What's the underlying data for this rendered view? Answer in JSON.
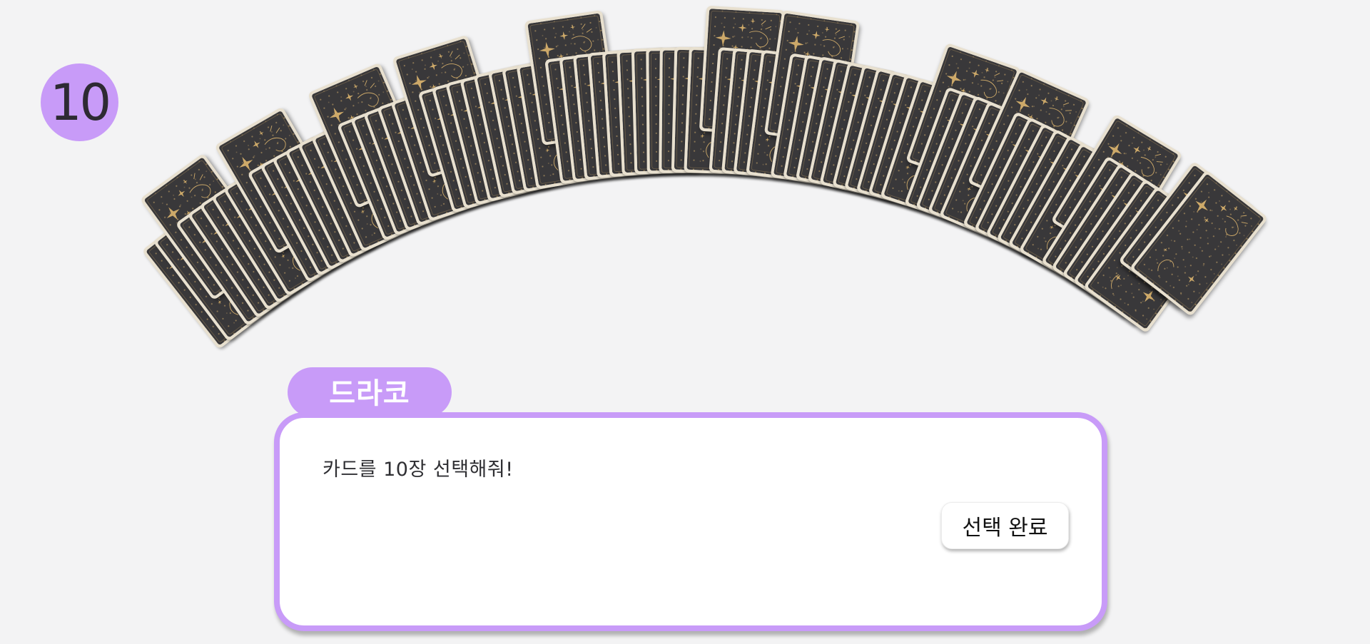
{
  "game": {
    "remaining_count": "10",
    "card_back_design": "celestial-tarot-back",
    "card_count_shown": 78,
    "raised_cards": [
      2,
      8,
      15,
      21,
      30,
      42,
      47,
      58,
      63,
      70,
      76,
      77
    ],
    "sun_card_index": 75
  },
  "dialog": {
    "speaker_name": "드라코",
    "message": "카드를 10장 선택해줘!",
    "confirm_label": "선택 완료"
  },
  "colors": {
    "background": "#f3f3f4",
    "accent_lavender": "#c89bf8",
    "card_back": "#39383a",
    "card_border": "#e8e0cf",
    "card_gold": "#cda969"
  }
}
